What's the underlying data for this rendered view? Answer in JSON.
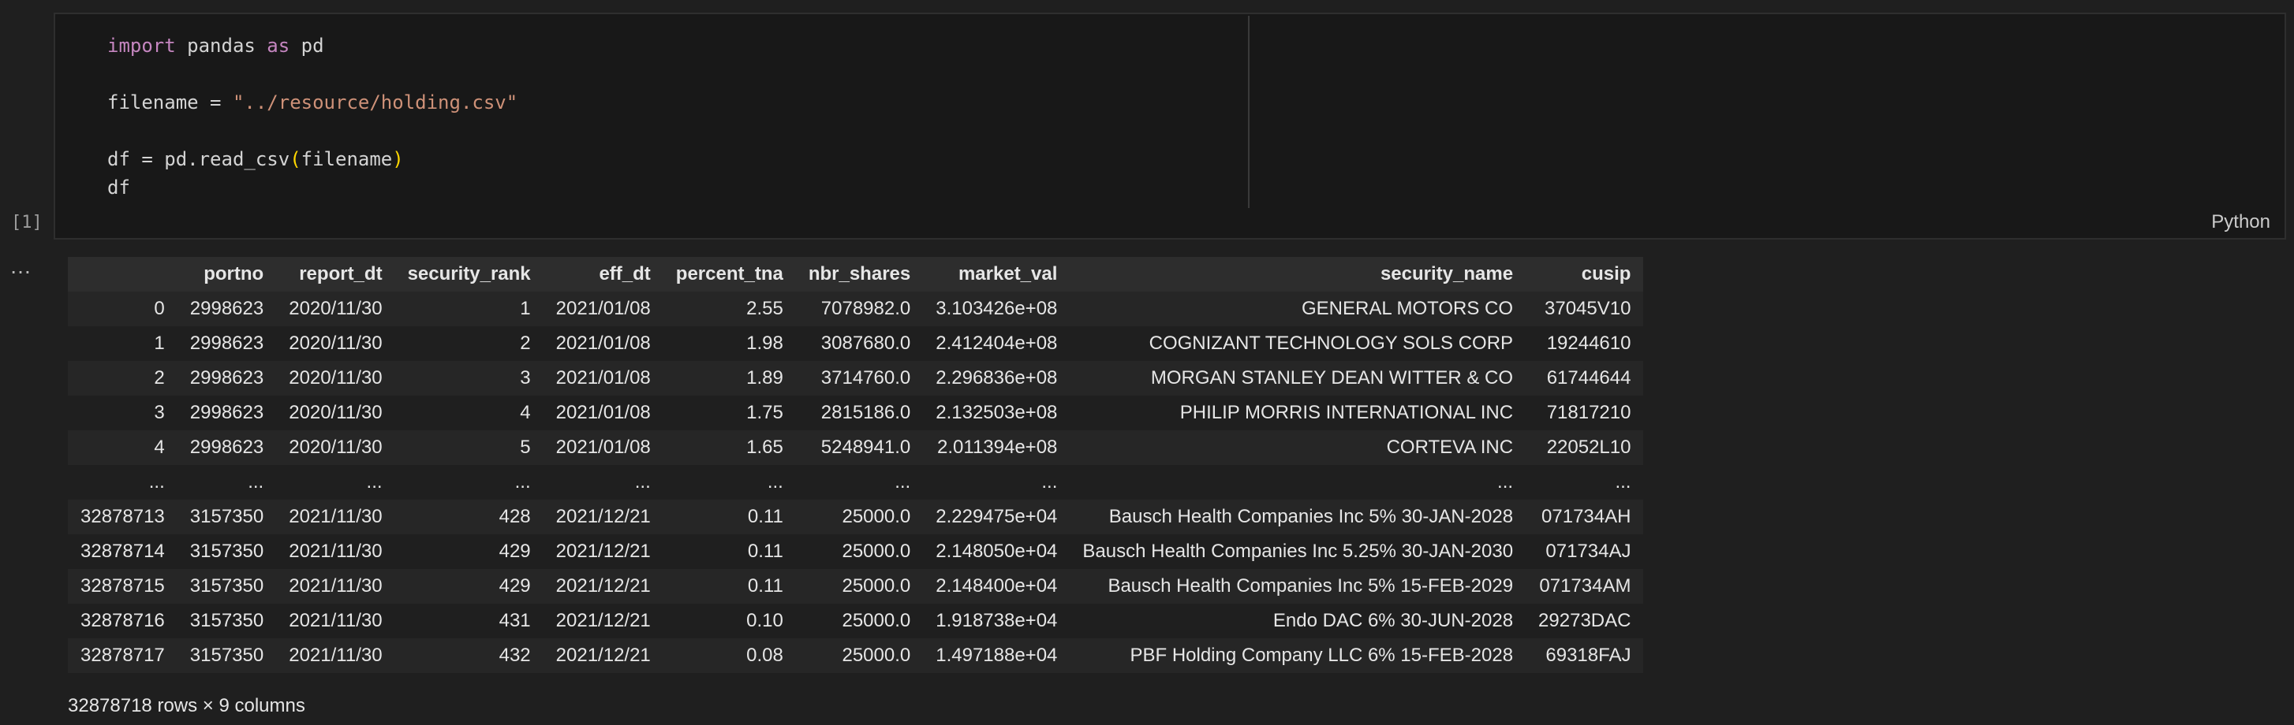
{
  "cell": {
    "code_lines": [
      [
        {
          "t": "import",
          "c": "kw"
        },
        {
          "t": " pandas ",
          "c": "plain"
        },
        {
          "t": "as",
          "c": "kw"
        },
        {
          "t": " pd",
          "c": "plain"
        }
      ],
      [],
      [
        {
          "t": "filename = ",
          "c": "plain"
        },
        {
          "t": "\"../resource/holding.csv\"",
          "c": "str"
        }
      ],
      [],
      [
        {
          "t": "df = pd.read_csv",
          "c": "plain"
        },
        {
          "t": "(",
          "c": "paren"
        },
        {
          "t": "filename",
          "c": "plain"
        },
        {
          "t": ")",
          "c": "paren"
        }
      ],
      [
        {
          "t": "df",
          "c": "plain"
        }
      ]
    ],
    "language": "Python",
    "execution_count": "[1]"
  },
  "output": {
    "ellipsis": "…",
    "table": {
      "columns": [
        "",
        "portno",
        "report_dt",
        "security_rank",
        "eff_dt",
        "percent_tna",
        "nbr_shares",
        "market_val",
        "security_name",
        "cusip"
      ],
      "rows": [
        [
          "0",
          "2998623",
          "2020/11/30",
          "1",
          "2021/01/08",
          "2.55",
          "7078982.0",
          "3.103426e+08",
          "GENERAL MOTORS CO",
          "37045V10"
        ],
        [
          "1",
          "2998623",
          "2020/11/30",
          "2",
          "2021/01/08",
          "1.98",
          "3087680.0",
          "2.412404e+08",
          "COGNIZANT TECHNOLOGY SOLS CORP",
          "19244610"
        ],
        [
          "2",
          "2998623",
          "2020/11/30",
          "3",
          "2021/01/08",
          "1.89",
          "3714760.0",
          "2.296836e+08",
          "MORGAN STANLEY DEAN WITTER & CO",
          "61744644"
        ],
        [
          "3",
          "2998623",
          "2020/11/30",
          "4",
          "2021/01/08",
          "1.75",
          "2815186.0",
          "2.132503e+08",
          "PHILIP MORRIS INTERNATIONAL INC",
          "71817210"
        ],
        [
          "4",
          "2998623",
          "2020/11/30",
          "5",
          "2021/01/08",
          "1.65",
          "5248941.0",
          "2.011394e+08",
          "CORTEVA INC",
          "22052L10"
        ],
        [
          "...",
          "...",
          "...",
          "...",
          "...",
          "...",
          "...",
          "...",
          "...",
          "..."
        ],
        [
          "32878713",
          "3157350",
          "2021/11/30",
          "428",
          "2021/12/21",
          "0.11",
          "25000.0",
          "2.229475e+04",
          "Bausch Health Companies Inc 5% 30-JAN-2028",
          "071734AH"
        ],
        [
          "32878714",
          "3157350",
          "2021/11/30",
          "429",
          "2021/12/21",
          "0.11",
          "25000.0",
          "2.148050e+04",
          "Bausch Health Companies Inc 5.25% 30-JAN-2030",
          "071734AJ"
        ],
        [
          "32878715",
          "3157350",
          "2021/11/30",
          "429",
          "2021/12/21",
          "0.11",
          "25000.0",
          "2.148400e+04",
          "Bausch Health Companies Inc 5% 15-FEB-2029",
          "071734AM"
        ],
        [
          "32878716",
          "3157350",
          "2021/11/30",
          "431",
          "2021/12/21",
          "0.10",
          "25000.0",
          "1.918738e+04",
          "Endo DAC 6% 30-JUN-2028",
          "29273DAC"
        ],
        [
          "32878717",
          "3157350",
          "2021/11/30",
          "432",
          "2021/12/21",
          "0.08",
          "25000.0",
          "1.497188e+04",
          "PBF Holding Company LLC 6% 15-FEB-2028",
          "69318FAJ"
        ]
      ]
    },
    "shape_text": "32878718 rows × 9 columns"
  }
}
